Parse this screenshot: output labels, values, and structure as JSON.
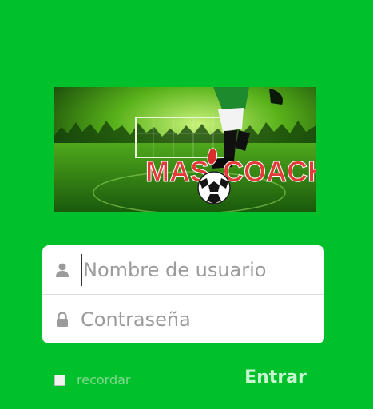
{
  "banner": {
    "logo_left": "MAS",
    "logo_right": "COACH"
  },
  "login": {
    "username_placeholder": "Nombre de usuario",
    "password_placeholder": "Contraseña",
    "remember_label": "recordar",
    "submit_label": "Entrar"
  },
  "colors": {
    "background": "#00c02c",
    "card": "#ffffff",
    "button_text": "#c8f5cf"
  },
  "icons": {
    "username": "user-icon",
    "password": "lock-icon",
    "banner_ball": "soccer-ball-icon"
  }
}
